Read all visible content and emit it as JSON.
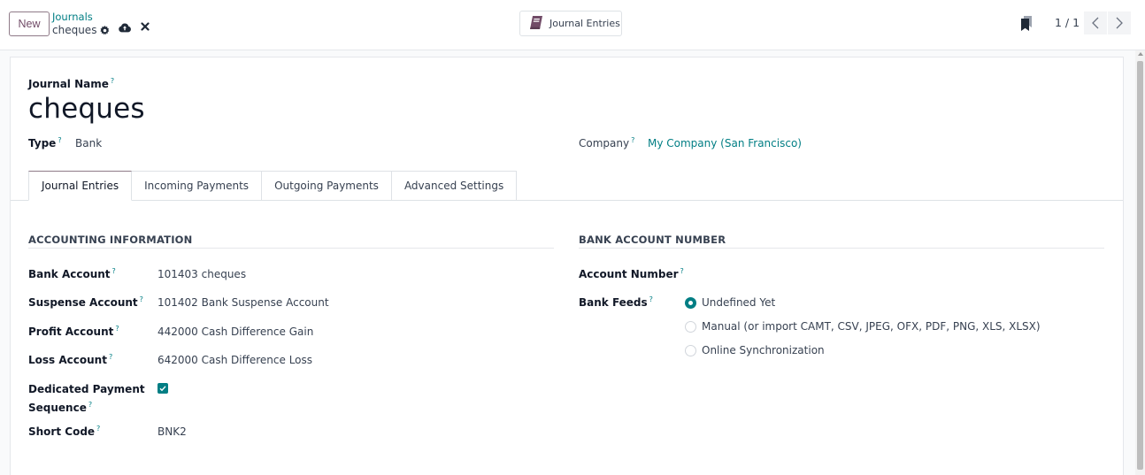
{
  "control_panel": {
    "new_label": "New",
    "breadcrumb_parent": "Journals",
    "breadcrumb_current": "cheques",
    "smart_button_label": "Journal Entries",
    "pager_value": "1 / 1"
  },
  "form": {
    "name_label": "Journal Name",
    "name_value": "cheques",
    "help_mark": "?",
    "type_label": "Type",
    "type_value": "Bank",
    "company_label": "Company",
    "company_value": "My Company (San Francisco)",
    "tabs": [
      {
        "label": "Journal Entries",
        "active": true
      },
      {
        "label": "Incoming Payments",
        "active": false
      },
      {
        "label": "Outgoing Payments",
        "active": false
      },
      {
        "label": "Advanced Settings",
        "active": false
      }
    ],
    "accounting": {
      "title": "ACCOUNTING INFORMATION",
      "fields": [
        {
          "label": "Bank Account",
          "value": "101403 cheques"
        },
        {
          "label": "Suspense Account",
          "value": "101402 Bank Suspense Account"
        },
        {
          "label": "Profit Account",
          "value": "442000 Cash Difference Gain"
        },
        {
          "label": "Loss Account",
          "value": "642000 Cash Difference Loss"
        }
      ],
      "dedicated_label_line1": "Dedicated Payment",
      "dedicated_label_line2": "Sequence",
      "dedicated_checked": true,
      "short_code_label": "Short Code",
      "short_code_value": "BNK2"
    },
    "bank_account": {
      "title": "BANK ACCOUNT NUMBER",
      "account_number_label": "Account Number",
      "account_number_value": "",
      "bank_feeds_label": "Bank Feeds",
      "bank_feeds_options": [
        {
          "label": "Undefined Yet",
          "checked": true
        },
        {
          "label": "Manual (or import CAMT, CSV, JPEG, OFX, PDF, PNG, XLS, XLSX)",
          "checked": false
        },
        {
          "label": "Online Synchronization",
          "checked": false
        }
      ]
    }
  },
  "colors": {
    "brand": "#714b67",
    "link": "#017e84",
    "checkbox": "#017e84"
  }
}
